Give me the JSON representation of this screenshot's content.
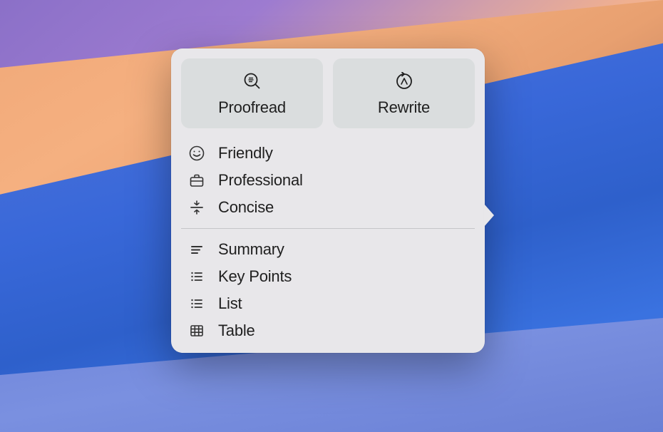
{
  "popover": {
    "buttons": {
      "proofread": {
        "label": "Proofread",
        "icon": "magnify-check-icon"
      },
      "rewrite": {
        "label": "Rewrite",
        "icon": "rewrite-cycle-icon"
      }
    },
    "tone_items": [
      {
        "label": "Friendly",
        "icon": "smile-icon"
      },
      {
        "label": "Professional",
        "icon": "briefcase-icon"
      },
      {
        "label": "Concise",
        "icon": "compress-lines-icon"
      }
    ],
    "format_items": [
      {
        "label": "Summary",
        "icon": "text-align-icon"
      },
      {
        "label": "Key Points",
        "icon": "bullet-list-icon"
      },
      {
        "label": "List",
        "icon": "bullet-list-icon"
      },
      {
        "label": "Table",
        "icon": "table-grid-icon"
      }
    ]
  }
}
